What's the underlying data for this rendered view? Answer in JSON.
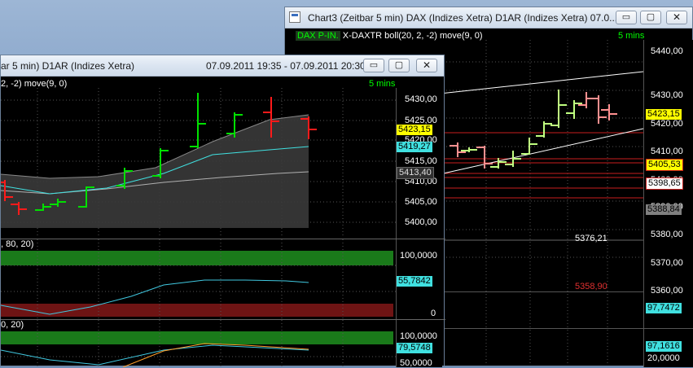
{
  "colors": {
    "accent_green": "#00ff00",
    "bar_up": "#00e000",
    "bar_down": "#ff1a1a",
    "band_fill": "#3a3a3a",
    "mid_line": "#b0b0b0",
    "ma_line": "#40e0e0",
    "osc_line": "#40c8e0",
    "osc2_line": "#ff9e2a",
    "overbought": "#1a7a1a",
    "oversold": "#6e1414",
    "last_price_bg": "#ffff00",
    "ma_price_bg": "#40e0e0",
    "red_level": "#c81e1e",
    "channel_line": "#ffffff"
  },
  "chart2": {
    "title": "ar 5 min)  D1AR (Indizes Xetra)",
    "date_range": "07.09.2011 19:35 - 07.09.2011 20:30",
    "study_label": "2, -2) move(9, 0)",
    "interval": "5 mins",
    "osc1_label": ", 80, 20)",
    "osc2_label": "0, 20)",
    "price_ticks": [
      "5430,00",
      "5425,00",
      "5420,00",
      "5415,00",
      "5410,00",
      "5405,00",
      "5400,00"
    ],
    "price_boxes": {
      "last": "5423,15",
      "ma": "5419,27",
      "lower": "5413,40"
    },
    "osc1": {
      "top": "100,0000",
      "value": "55,7842",
      "bottom": "0"
    },
    "osc2": {
      "top": "100,0000",
      "value": "79,5748",
      "bottom": "50,0000"
    },
    "buttons": {
      "minimize": "▭",
      "maximize": "▢",
      "close": "✕"
    }
  },
  "chart3": {
    "title": "Chart3 (Zeitbar 5 min)  DAX (Indizes Xetra) D1AR (Indizes Xetra) 07.0...",
    "study_label_symbol": "DAX P-IN.",
    "study_label": "X-DAXTR boll(20, 2, -2) move(9, 0)",
    "interval": "5 mins",
    "price_ticks": [
      "5440,00",
      "5430,00",
      "5420,00",
      "5410,00",
      "5400,00",
      "5390,00",
      "5380,00",
      "5370,00",
      "5360,00"
    ],
    "price_boxes": {
      "last": "5423,15",
      "red1": "5405,53",
      "red2": "5398,65",
      "grey": "5388,84"
    },
    "annotation_high": "5376,21",
    "annotation_low": "5358,90",
    "osc1_value": "97,7472",
    "osc2_value": "97,1616",
    "osc2_bottom": "20,0000",
    "buttons": {
      "minimize": "▭",
      "maximize": "▢",
      "close": "✕"
    }
  }
}
